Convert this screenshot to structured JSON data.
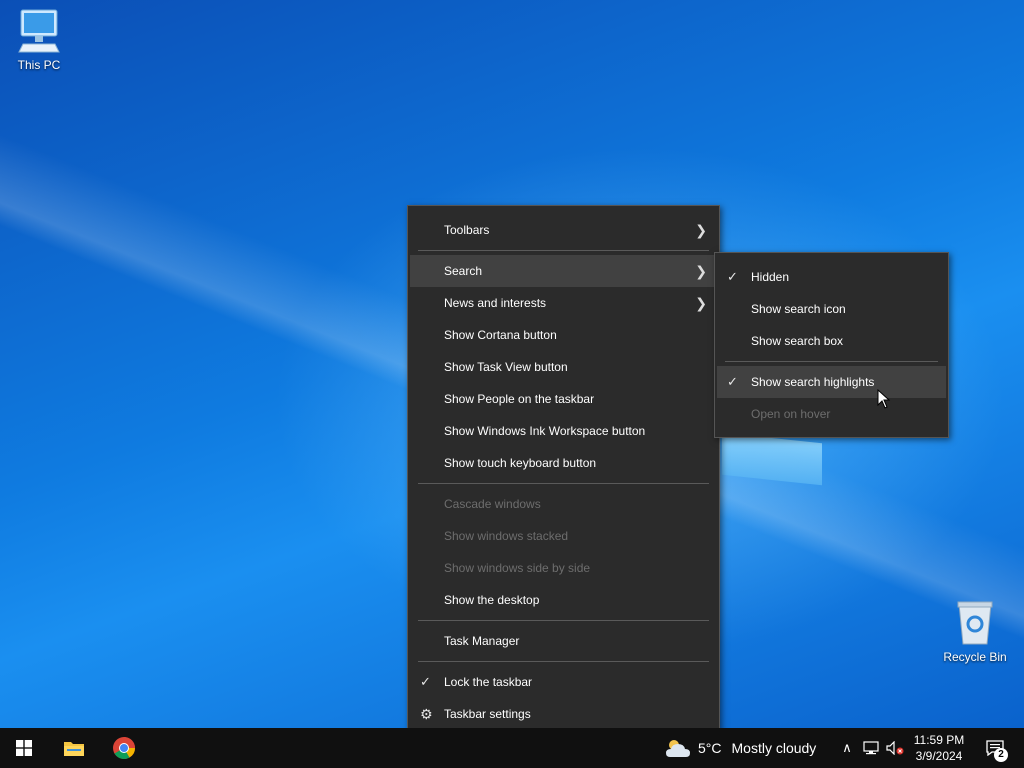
{
  "desktop": {
    "icons": [
      {
        "label": "This PC"
      },
      {
        "label": "Recycle Bin"
      }
    ]
  },
  "context_menu": {
    "items": [
      {
        "label": "Toolbars",
        "submenu": true,
        "state": "normal"
      },
      {
        "label": "Search",
        "submenu": true,
        "state": "highlighted"
      },
      {
        "label": "News and interests",
        "submenu": true,
        "state": "normal"
      },
      {
        "label": "Show Cortana button",
        "state": "normal"
      },
      {
        "label": "Show Task View button",
        "state": "normal"
      },
      {
        "label": "Show People on the taskbar",
        "state": "normal"
      },
      {
        "label": "Show Windows Ink Workspace button",
        "state": "normal"
      },
      {
        "label": "Show touch keyboard button",
        "state": "normal"
      },
      {
        "label": "Cascade windows",
        "state": "disabled"
      },
      {
        "label": "Show windows stacked",
        "state": "disabled"
      },
      {
        "label": "Show windows side by side",
        "state": "disabled"
      },
      {
        "label": "Show the desktop",
        "state": "normal"
      },
      {
        "label": "Task Manager",
        "state": "normal"
      },
      {
        "label": "Lock the taskbar",
        "checked": true,
        "state": "normal"
      },
      {
        "label": "Taskbar settings",
        "icon": "gear-icon",
        "state": "normal"
      }
    ]
  },
  "search_submenu": {
    "items": [
      {
        "label": "Hidden",
        "checked": true,
        "state": "normal"
      },
      {
        "label": "Show search icon",
        "state": "normal"
      },
      {
        "label": "Show search box",
        "state": "normal"
      },
      {
        "label": "Show search highlights",
        "checked": true,
        "state": "highlighted"
      },
      {
        "label": "Open on hover",
        "state": "disabled"
      }
    ]
  },
  "glyphs": {
    "check": "✓",
    "chevron": "❯",
    "gear": "⚙",
    "up": "∧"
  },
  "taskbar": {
    "weather": {
      "temp": "5°C",
      "condition": "Mostly cloudy"
    },
    "clock": {
      "time": "11:59 PM",
      "date": "3/9/2024"
    },
    "notification_count": "2"
  },
  "colors": {
    "menu_bg": "#2b2b2b",
    "menu_highlight": "#414141",
    "taskbar_bg": "#101010",
    "disabled_text": "#6d6d6d"
  }
}
